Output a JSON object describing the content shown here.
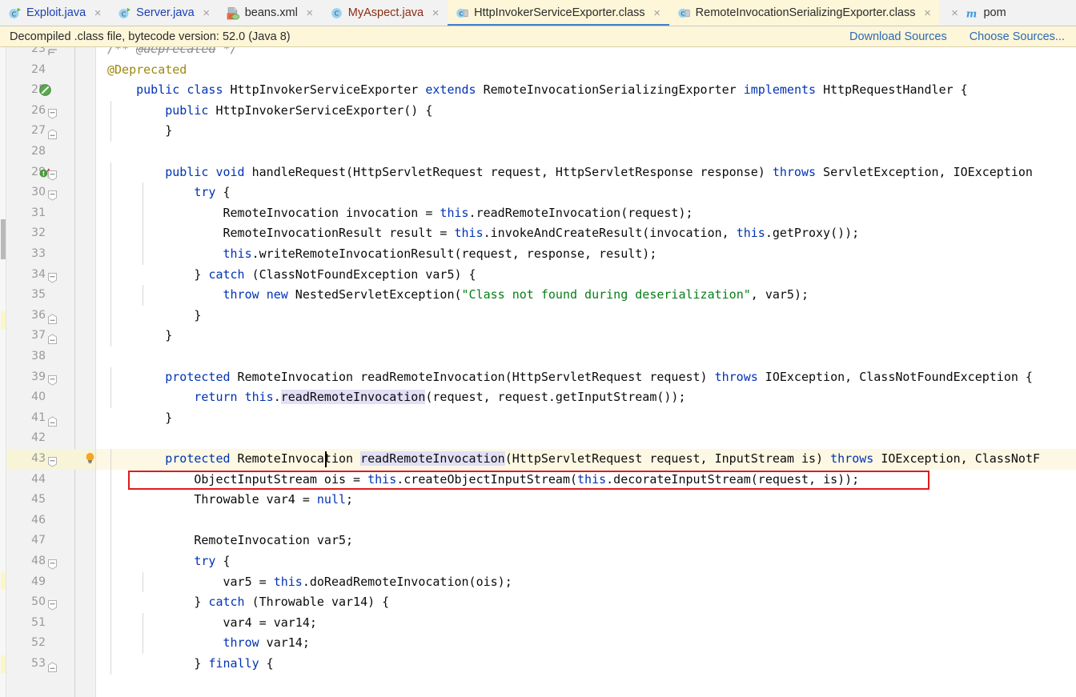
{
  "window": {
    "title": "HttpInvokerServiceExporter.class"
  },
  "tabs": [
    {
      "label": "Exploit.java",
      "icon": "java-class-run-icon",
      "state": "inactive",
      "color": "java"
    },
    {
      "label": "Server.java",
      "icon": "java-class-run-icon",
      "state": "inactive",
      "color": "java"
    },
    {
      "label": "beans.xml",
      "icon": "spring-xml-icon",
      "state": "inactive",
      "color": "xml"
    },
    {
      "label": "MyAspect.java",
      "icon": "java-class-icon",
      "state": "inactive",
      "color": "aspect"
    },
    {
      "label": "HttpInvokerServiceExporter.class",
      "icon": "class-file-icon",
      "state": "selected",
      "color": "cls"
    },
    {
      "label": "RemoteInvocationSerializingExporter.class",
      "icon": "class-file-icon",
      "state": "active-file",
      "color": "cls"
    },
    {
      "label": "pom",
      "icon": "maven-icon",
      "state": "inactive",
      "color": "cls"
    }
  ],
  "tab_close_glyph": "×",
  "banner": {
    "text": "Decompiled .class file, bytecode version: 52.0 (Java 8)",
    "links": [
      {
        "label": "Download Sources",
        "name": "download-sources-link"
      },
      {
        "label": "Choose Sources...",
        "name": "choose-sources-link"
      }
    ]
  },
  "editor": {
    "first_line": 23,
    "current_line": 43,
    "caret_line": 43,
    "colors": {
      "keyword": "#0033b3",
      "string": "#067d17",
      "number": "#1750eb",
      "comment": "#8c8c8c",
      "annotation": "#9e880d",
      "highlight": "#e2dff7",
      "current_line_bg": "#fcf8e3",
      "error_box": "#e01b1b",
      "link": "#2b6ab5"
    },
    "lines": [
      {
        "n": 23,
        "fold": "start-doc",
        "text": "    /** @deprecated */",
        "kind": "comment-deprecated"
      },
      {
        "n": 24,
        "text": "    @Deprecated",
        "kind": "annotation"
      },
      {
        "n": 25,
        "gicon": "deprecated-marker-icon",
        "text": "    public class HttpInvokerServiceExporter extends RemoteInvocationSerializingExporter implements HttpRequestHandler {"
      },
      {
        "n": 26,
        "fold": "open",
        "text": "        public HttpInvokerServiceExporter() {"
      },
      {
        "n": 27,
        "fold": "end",
        "text": "        }"
      },
      {
        "n": 28,
        "text": ""
      },
      {
        "n": 29,
        "gicon": "overriding-method-icon",
        "fold": "open",
        "text": "        public void handleRequest(HttpServletRequest request, HttpServletResponse response) throws ServletException, IOException"
      },
      {
        "n": 30,
        "fold": "open",
        "text": "            try {"
      },
      {
        "n": 31,
        "text": "                RemoteInvocation invocation = this.readRemoteInvocation(request);"
      },
      {
        "n": 32,
        "text": "                RemoteInvocationResult result = this.invokeAndCreateResult(invocation, this.getProxy());"
      },
      {
        "n": 33,
        "text": "                this.writeRemoteInvocationResult(request, response, result);"
      },
      {
        "n": 34,
        "fold": "open",
        "text": "            } catch (ClassNotFoundException var5) {"
      },
      {
        "n": 35,
        "text": "                throw new NestedServletException(\"Class not found during deserialization\", var5);"
      },
      {
        "n": 36,
        "fold": "end",
        "text": "            }"
      },
      {
        "n": 37,
        "fold": "end",
        "text": "        }"
      },
      {
        "n": 38,
        "text": ""
      },
      {
        "n": 39,
        "fold": "open",
        "text": "        protected RemoteInvocation readRemoteInvocation(HttpServletRequest request) throws IOException, ClassNotFoundException {"
      },
      {
        "n": 40,
        "text": "            return this.readRemoteInvocation(request, request.getInputStream());"
      },
      {
        "n": 41,
        "fold": "end",
        "text": "        }"
      },
      {
        "n": 42,
        "text": ""
      },
      {
        "n": 43,
        "fold": "open",
        "bulb": "intention-bulb-icon",
        "current": true,
        "text": "        protected RemoteInvocation readRemoteInvocation(HttpServletRequest request, InputStream is) throws IOException, ClassNotF"
      },
      {
        "n": 44,
        "boxed": true,
        "text": "            ObjectInputStream ois = this.createObjectInputStream(this.decorateInputStream(request, is));"
      },
      {
        "n": 45,
        "text": "            Throwable var4 = null;"
      },
      {
        "n": 46,
        "text": ""
      },
      {
        "n": 47,
        "text": "            RemoteInvocation var5;"
      },
      {
        "n": 48,
        "fold": "open",
        "text": "            try {"
      },
      {
        "n": 49,
        "text": "                var5 = this.doReadRemoteInvocation(ois);"
      },
      {
        "n": 50,
        "fold": "open",
        "text": "            } catch (Throwable var14) {"
      },
      {
        "n": 51,
        "text": "                var4 = var14;"
      },
      {
        "n": 52,
        "text": "                throw var14;"
      },
      {
        "n": 53,
        "fold": "end",
        "text": "            } finally {"
      }
    ],
    "highlighted_symbol": "readRemoteInvocation"
  }
}
